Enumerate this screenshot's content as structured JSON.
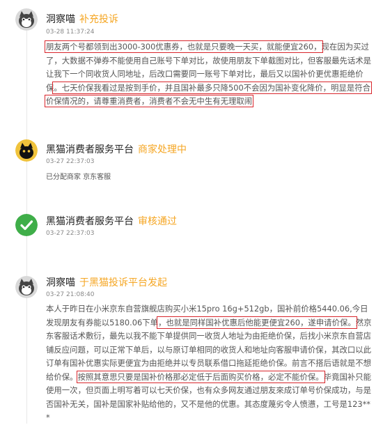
{
  "entries": [
    {
      "user": "洞察喵",
      "status": "补充投诉",
      "time": "03-28 11:37:24",
      "paragraph": [
        {
          "t": "朋友两个号都领到出3000-300优惠券，也就是只要晚一天买，就能便宜260，",
          "hl": true
        },
        {
          "t": "现在因为买过了，大数据不弹券不能使用自己账号下单对比，故使用朋友下单截图对比，但客服最先话术是让我下一个同收货人同地址，后改口需要同一账号下单对比，最后又以国补价更优惠拒绝价保",
          "hl": false
        },
        {
          "t": "。七天价保我看过是按到手价，并且国补最多只降500不会因为国补变化降价，明显是符合价保情况的，请尊重消费者，消费者不会无中生有无理取闹",
          "hl": true
        }
      ]
    },
    {
      "user": "黑猫消费者服务平台",
      "status": "商家处理中",
      "time": "03-27 22:37:03",
      "text": "已分配商家  京东客服"
    },
    {
      "user": "黑猫消费者服务平台",
      "status": "审核通过",
      "time": "03-27 22:37:03"
    },
    {
      "user": "洞察喵",
      "status": "于黑猫投诉平台发起",
      "time": "03-27 21:08:40",
      "paragraph": [
        {
          "t": "本人于昨日在小米京东自营旗舰店购买小米15pro 16g+512gb，国补前价格5440.06,今日发现朋友有券能以5180.06下单",
          "hl": false
        },
        {
          "t": "，也就是同样国补优惠后他能更便宜260，遂申请价保。",
          "hl": true
        },
        {
          "t": "然京东客服话术敷衍，最先以我不能下单提供同一收货人地址为由拒绝价保，后找小米京东自营店铺反应问题，可以正常下单后，以与原订单相同的收货人和地址向客服申请价保，其改口以此订单有国补优惠实际更便宜为由拒绝并以专员联系借口拖延拒绝价保。前言不搭后语就是不想给价保。",
          "hl": false
        },
        {
          "t": "按照其意思只要是国补价格那必定低于后面购买价格，必定不能价保。",
          "hl": true
        },
        {
          "t": "毕竟国补只能使用一次，但页面上明写着可以七天价保，也有众多网友通过朋友來成订单号价保成功，与是否国补无关，国补是国家补贴给他的，又不是他的优惠。其态度蔑劣令人愤懑，工号是123***",
          "hl": false
        }
      ]
    }
  ]
}
